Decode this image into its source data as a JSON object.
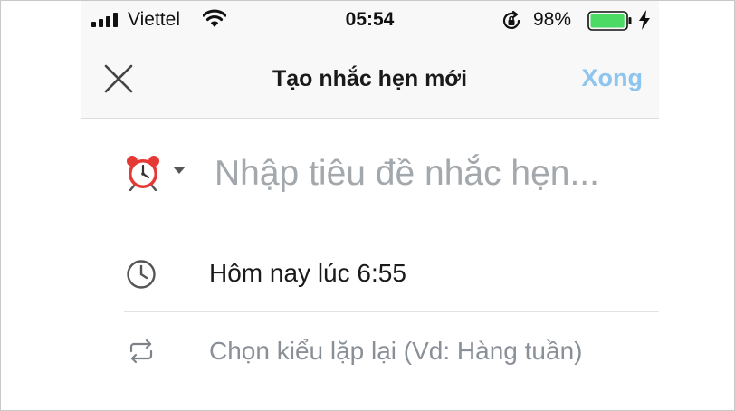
{
  "status_bar": {
    "carrier": "Viettel",
    "time": "05:54",
    "battery_percent": "98%",
    "battery_level": 0.98,
    "battery_color": "#4cd964",
    "icons": [
      "signal-icon",
      "wifi-icon",
      "rotation-lock-icon",
      "battery-icon",
      "charging-bolt-icon"
    ]
  },
  "nav": {
    "title": "Tạo nhắc hẹn mới",
    "close_icon": "close-icon",
    "done_label": "Xong",
    "done_color": "#8ec5ee"
  },
  "form": {
    "reminder_icon": "alarm-clock-icon",
    "title_placeholder": "Nhập tiêu đề nhắc hẹn...",
    "title_value": "",
    "time_icon": "clock-icon",
    "time_label": "Hôm nay lúc 6:55",
    "repeat_icon": "repeat-icon",
    "repeat_label": "Chọn kiểu lặp lại (Vd: Hàng tuần)"
  }
}
